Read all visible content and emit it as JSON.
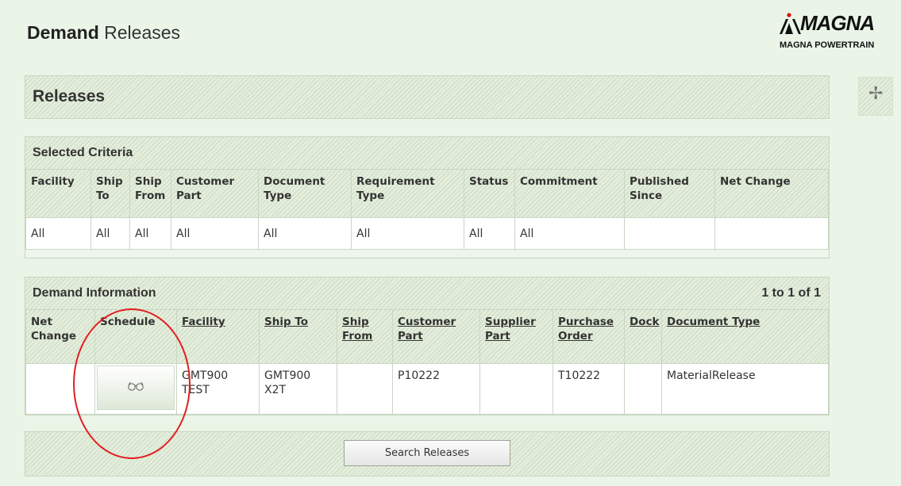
{
  "header": {
    "title_bold": "Demand",
    "title_rest": "Releases",
    "logo_word": "MAGNA",
    "logo_sub": "MAGNA POWERTRAIN"
  },
  "releases_bar": {
    "title": "Releases",
    "expand_icon": "plus-icon"
  },
  "selected_criteria": {
    "title": "Selected Criteria",
    "columns": [
      "Facility",
      "Ship To",
      "Ship From",
      "Customer Part",
      "Document Type",
      "Requirement Type",
      "Status",
      "Commitment",
      "Published Since",
      "Net Change"
    ],
    "row": [
      "All",
      "All",
      "All",
      "All",
      "All",
      "All",
      "All",
      "All",
      "",
      ""
    ]
  },
  "demand_information": {
    "title": "Demand Information",
    "paging": "1 to 1 of 1",
    "columns": [
      "Net Change",
      "Schedule",
      "Facility",
      "Ship To",
      "Ship From",
      "Customer Part",
      "Supplier Part",
      "Purchase Order",
      "Dock",
      "Document Type"
    ],
    "rows": [
      {
        "net_change": "",
        "schedule_icon": "glasses-icon",
        "facility": "GMT900 TEST",
        "ship_to": "GMT900 X2T",
        "ship_from": "",
        "customer_part": "P10222",
        "supplier_part": "",
        "purchase_order": "T10222",
        "dock": "",
        "document_type": "MaterialRelease"
      }
    ]
  },
  "footer": {
    "search_button": "Search Releases"
  },
  "colors": {
    "page_bg": "#eaf5e8",
    "annotation": "#e02020"
  }
}
